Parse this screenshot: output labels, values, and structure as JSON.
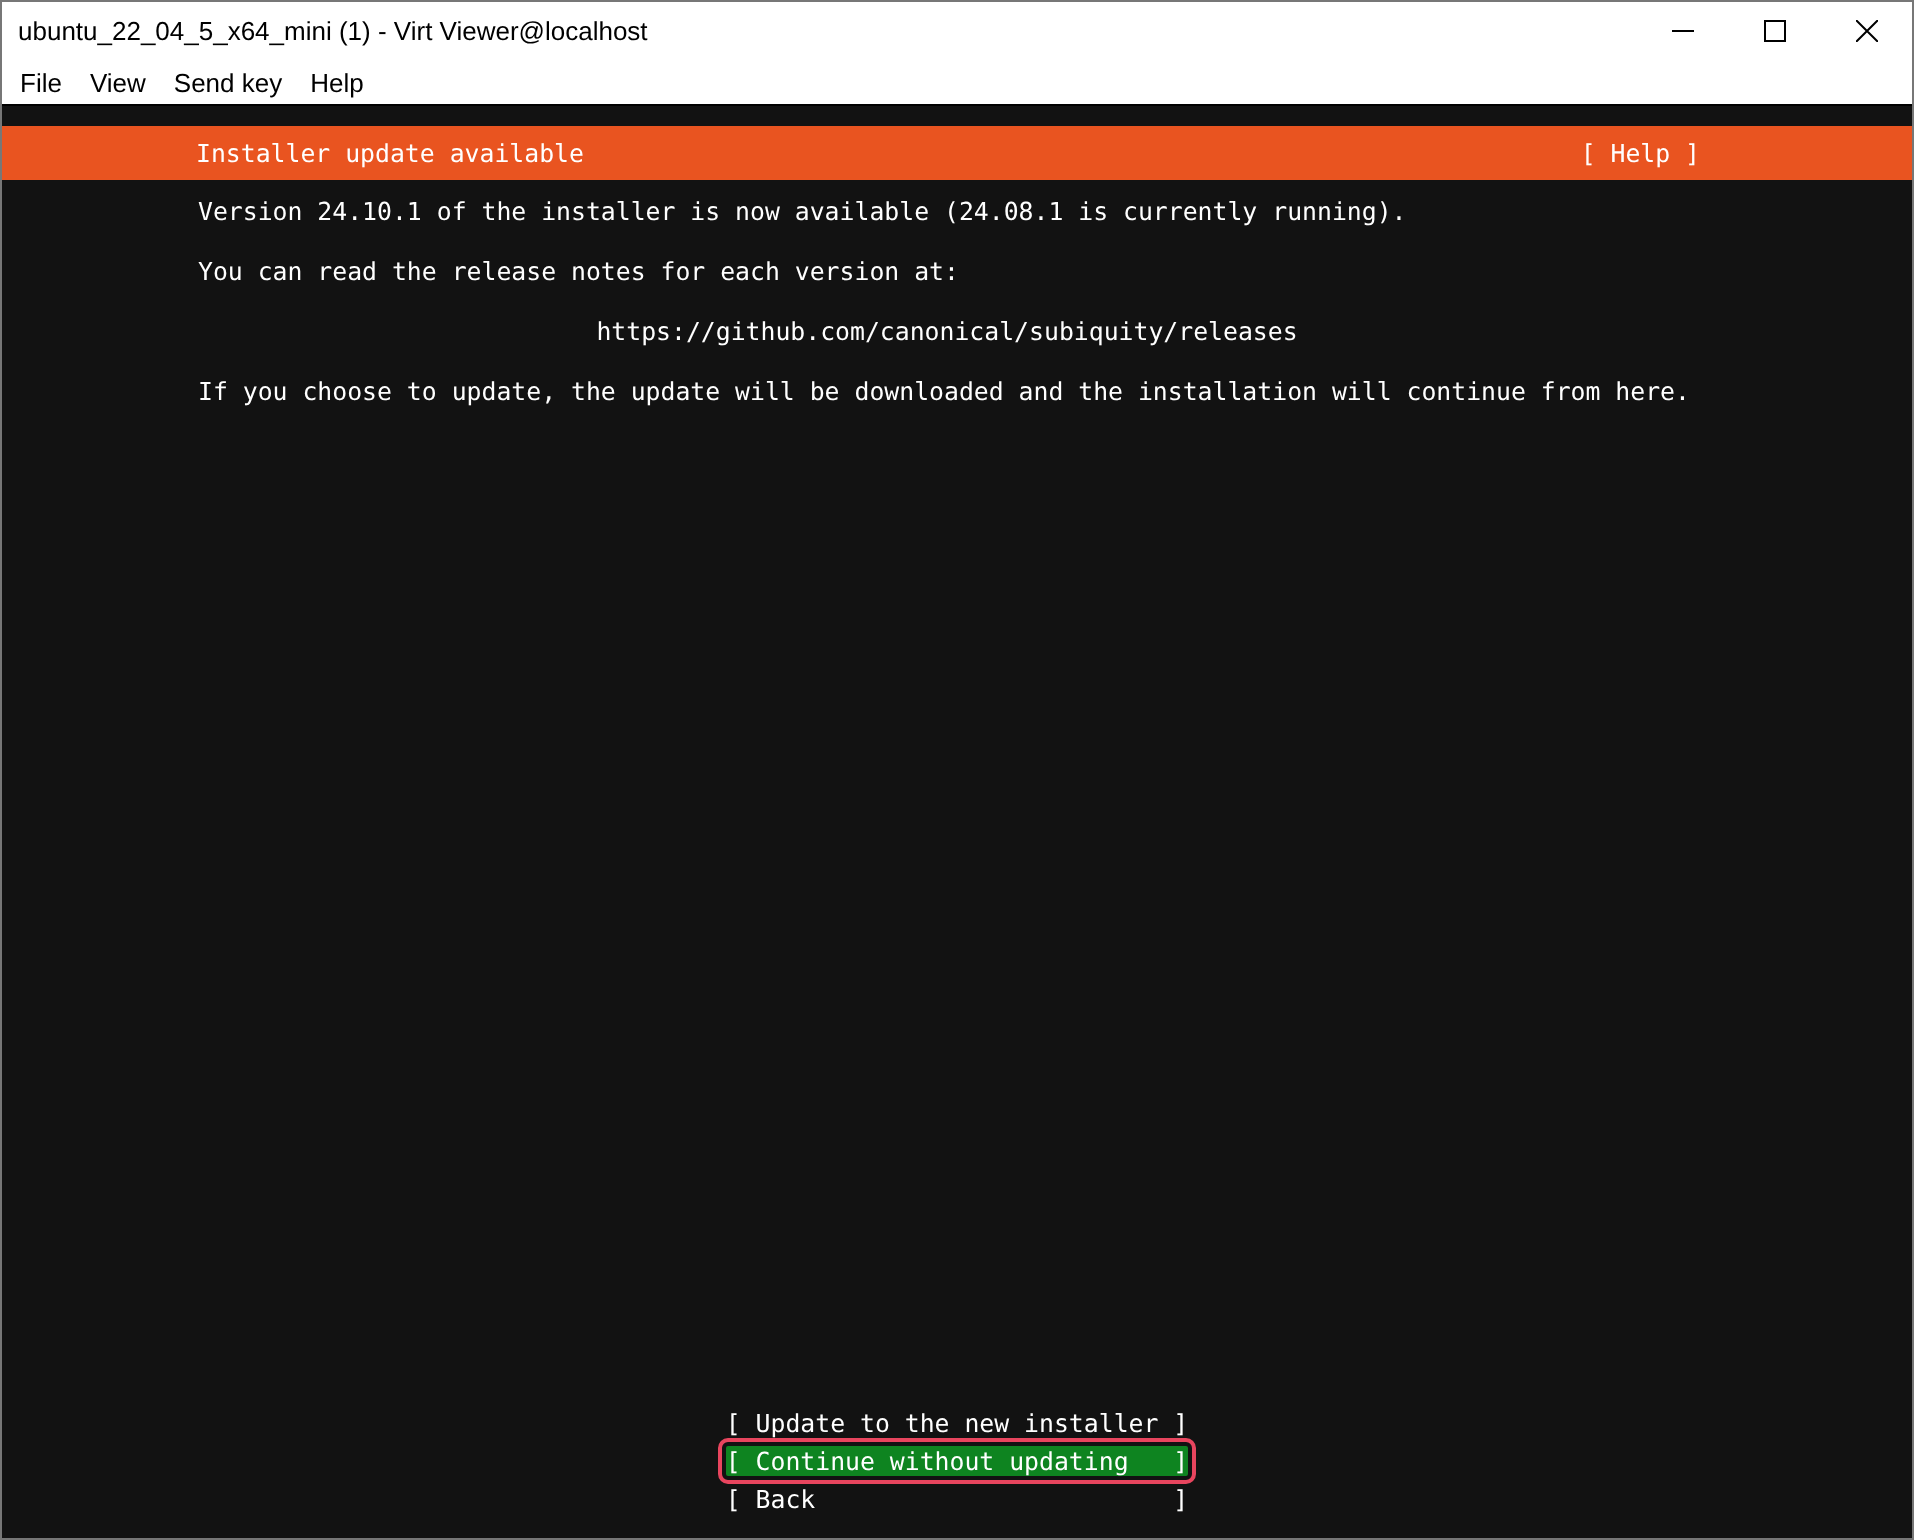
{
  "window": {
    "title": "ubuntu_22_04_5_x64_mini (1) - Virt Viewer@localhost"
  },
  "menu": [
    "File",
    "View",
    "Send key",
    "Help"
  ],
  "header": {
    "title": "Installer update available",
    "help": "[ Help ]"
  },
  "lines": [
    {
      "kind": "text",
      "text": "Version 24.10.1 of the installer is now available (24.08.1 is currently running)."
    },
    {
      "kind": "text",
      "text": "You can read the release notes for each version at:"
    },
    {
      "kind": "link",
      "text": "https://github.com/canonical/subiquity/releases"
    },
    {
      "kind": "text",
      "text": "If you choose to update, the update will be downloaded and the installation will continue from here."
    }
  ],
  "buttons": [
    {
      "label": "[ Update to the new installer ]",
      "selected": false
    },
    {
      "label": "[ Continue without updating   ]",
      "selected": true
    },
    {
      "label": "[ Back                        ]",
      "selected": false
    }
  ]
}
